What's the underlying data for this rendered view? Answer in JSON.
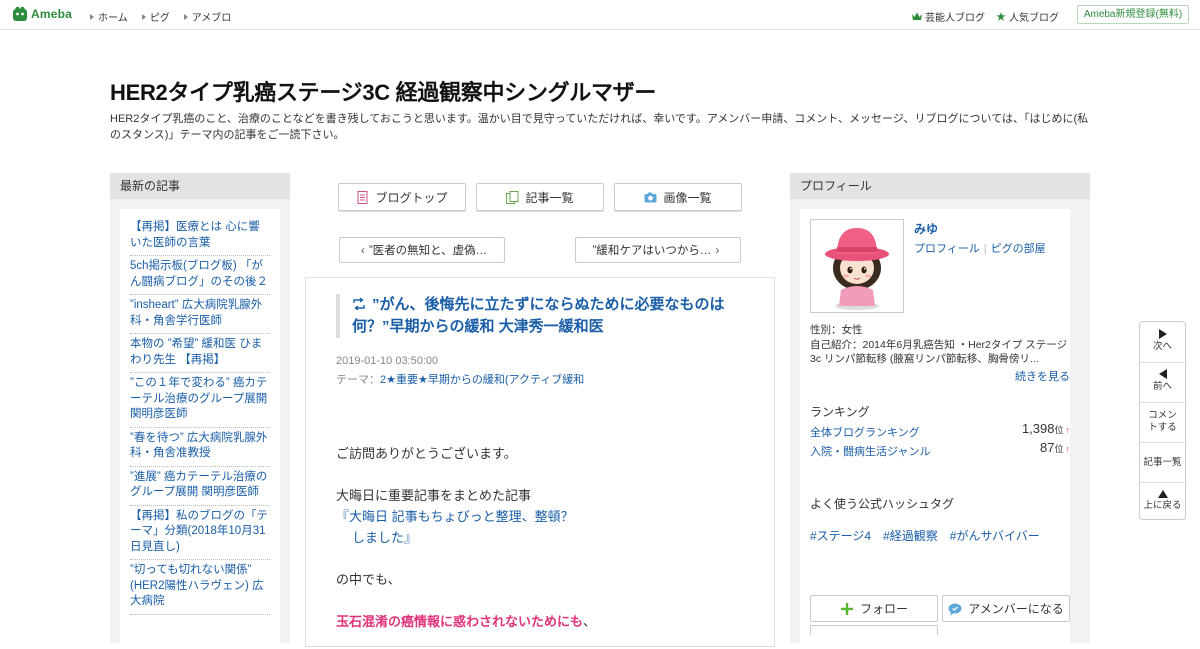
{
  "topbar": {
    "logo_text": "Ameba",
    "nav": [
      "ホーム",
      "ピグ",
      "アメブロ"
    ],
    "celebrity_blog": "芸能人ブログ",
    "popular_blog": "人気ブログ",
    "signup": "Ameba新規登録(無料)"
  },
  "header": {
    "title": "HER2タイプ乳癌ステージ3C 経過観察中シングルマザー",
    "description": "HER2タイプ乳癌のこと、治療のことなどを書き残しておこうと思います。温かい目で見守っていただければ、幸いです。アメンバー申請、コメント、メッセージ、リブログについては、「はじめに(私のスタンス)」テーマ内の記事をご一読下さい。"
  },
  "recent": {
    "heading": "最新の記事",
    "items": [
      "【再掲】医療とは 心に響いた医師の言葉",
      "5ch掲示板(ブログ板) 「がん闘病ブログ」のその後２",
      "”insheart” 広大病院乳腺外科・角舎学行医師",
      "本物の ”希望” 緩和医 ひまわり先生 【再掲】",
      "”この１年で変わる” 癌カテーテル治療のグループ展開 関明彦医師",
      "”春を待つ” 広大病院乳腺外科・角舎准教授",
      "”進展” 癌カテーテル治療のグループ展開 関明彦医師",
      "【再掲】私のブログの「テーマ」分類(2018年10月31日見直し)",
      "”切っても切れない関係” (HER2陽性ハラヴェン) 広大病院"
    ]
  },
  "center": {
    "btn_top": "ブログトップ",
    "btn_list": "記事一覧",
    "btn_images": "画像一覧",
    "prev": "”医者の無知と、虚偽…",
    "next": "”緩和ケアはいつから…",
    "article": {
      "title": "”がん、後悔先に立たずにならぬために必要なものは何？”早期からの緩和 大津秀一緩和医",
      "date": "2019-01-10 03:50:00",
      "theme_label": "テーマ：",
      "theme": "2★重要★早期からの緩和(アクティブ緩和",
      "line1": "ご訪問ありがとうございます。",
      "line2": "大晦日に重要記事をまとめた記事",
      "link_open": "『",
      "link_text1": "大晦日  記事もちょびっと整理、整頓？",
      "link_text2": "しました",
      "link_close": "』",
      "line3": "の中でも、",
      "line4_pink": "玉石混淆の癌情報に惑わされないためにも",
      "line4_end": "、"
    }
  },
  "profile": {
    "heading": "プロフィール",
    "name": "みゆ",
    "link_profile": "プロフィール",
    "link_pig": "ピグの部屋",
    "gender": "性別：女性",
    "intro": "自己紹介：2014年6月乳癌告知 ・Her2タイプ ステージ3c リンパ節転移 (腋窩リンパ節転移、胸骨傍リ...",
    "more": "続きを見る",
    "ranking_heading": "ランキング",
    "ranking": [
      {
        "label": "全体ブログランキング",
        "value": "1,398",
        "unit": "位",
        "trend": "↑"
      },
      {
        "label": "入院・闘病生活ジャンル",
        "value": "87",
        "unit": "位",
        "trend": "↑"
      }
    ],
    "hashtag_heading": "よく使う公式ハッシュタグ",
    "hashtags": [
      "#ステージ4",
      "#経過観察",
      "#がんサバイバー"
    ],
    "follow": "フォロー",
    "amember": "アメンバーになる"
  },
  "sidenav": {
    "next": "次へ",
    "prev": "前へ",
    "comment": "コメントする",
    "list": "記事一覧",
    "top": "上に戻る"
  }
}
